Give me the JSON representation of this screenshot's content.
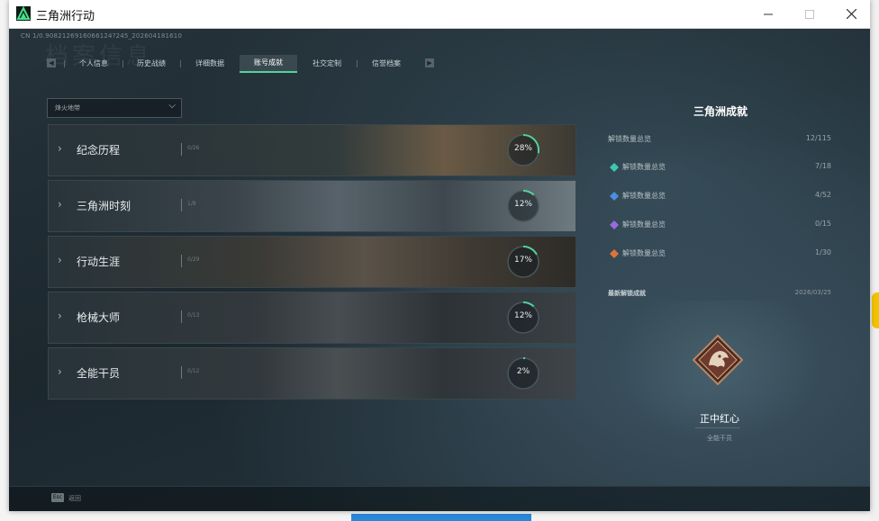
{
  "window": {
    "title": "三角洲行动"
  },
  "version_text": "CN 1/0.9082126916066124?245_202604181610",
  "ghost_title": "档案信息",
  "tabs": [
    {
      "label": "个人信息",
      "active": false
    },
    {
      "label": "历史战绩",
      "active": false
    },
    {
      "label": "详细数据",
      "active": false
    },
    {
      "label": "账号成就",
      "active": true
    },
    {
      "label": "社交定制",
      "active": false
    },
    {
      "label": "信誉档案",
      "active": false
    }
  ],
  "filter": {
    "selected": "烽火地带"
  },
  "categories": [
    {
      "name": "纪念历程",
      "sub": "0/26",
      "percent": 0.28,
      "percent_text": "28%"
    },
    {
      "name": "三角洲时刻",
      "sub": "1/8",
      "percent": 0.12,
      "percent_text": "12%"
    },
    {
      "name": "行动生涯",
      "sub": "0/29",
      "percent": 0.17,
      "percent_text": "17%"
    },
    {
      "name": "枪械大师",
      "sub": "0/13",
      "percent": 0.12,
      "percent_text": "12%"
    },
    {
      "name": "全能干员",
      "sub": "0/12",
      "percent": 0.02,
      "percent_text": "2%"
    }
  ],
  "right_panel": {
    "title": "三角洲成就",
    "summary": {
      "label": "解锁数量总览",
      "value": "12/115"
    },
    "rows": [
      {
        "label": "解锁数量总览",
        "value": "7/18",
        "icon": "teal-diamond-icon",
        "color": "#3ec7b0"
      },
      {
        "label": "解锁数量总览",
        "value": "4/52",
        "icon": "blue-diamond-icon",
        "color": "#4a8fe0"
      },
      {
        "label": "解锁数量总览",
        "value": "0/15",
        "icon": "purple-diamond-icon",
        "color": "#9a6ae0"
      },
      {
        "label": "解锁数量总览",
        "value": "1/30",
        "icon": "orange-diamond-icon",
        "color": "#e0733a"
      }
    ],
    "latest_label": "最新解锁成就",
    "latest_date": "2026/03/25",
    "badge": {
      "name": "正中红心",
      "category": "全能干员"
    }
  },
  "footer": {
    "key": "Esc",
    "label": "返回"
  },
  "colors": {
    "accent": "#52d39a",
    "ring_track": "#4a565c",
    "panel": "#1b242b"
  }
}
